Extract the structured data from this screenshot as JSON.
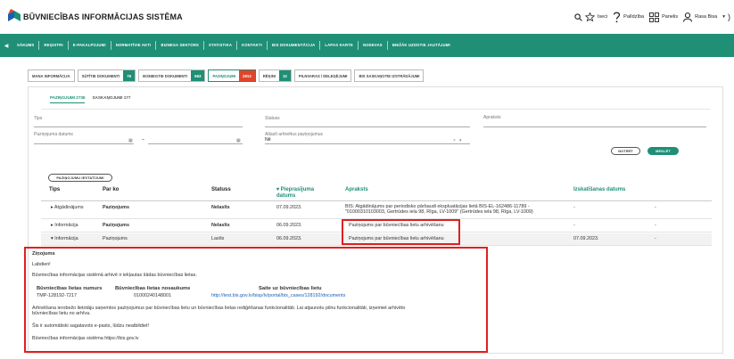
{
  "app": {
    "title": "BŪVNIECĪBAS INFORMĀCIJAS SISTĒMA"
  },
  "header": {
    "search_label": "Iseci",
    "help_label": "Palīdzība",
    "panel_label": "Panelis",
    "user_label": "Rasa Bisa"
  },
  "nav": {
    "items": [
      "SĀKUMS",
      "REĢISTRI",
      "E-PAKALPOJUMI",
      "NORMATĪVIE AKTI",
      "BIZNESA SEKTORS",
      "STATISTIKA",
      "KONTAKTI",
      "BIS DOKUMENTĀCIJA",
      "LAPAS KARTE",
      "NODEVAS",
      "BIEŽĀK UZDOTIE JAUTĀJUMI"
    ]
  },
  "doc_tabs": [
    {
      "label": "MANA INFORMĀCIJA",
      "count": ""
    },
    {
      "label": "SŪTĪTIE DOKUMENTI",
      "count": "76"
    },
    {
      "label": "IESNIEGTIE DOKUMENTI",
      "count": "663"
    },
    {
      "label": "PAZIŅOJUMI",
      "count": "2912"
    },
    {
      "label": "RĒĶINI",
      "count": "12"
    },
    {
      "label": "PILNVARAS / DELEĢĒJUMI",
      "count": ""
    },
    {
      "label": "BIS SASKAŅOTIE IZSTRĀDĀJUMI",
      "count": ""
    }
  ],
  "sub_tabs": [
    "PAZIŅOJUMI 2735",
    "SASKAŅOJUMI 177"
  ],
  "filters": {
    "tips_label": "Tips",
    "statuss_label": "Statuss",
    "apraksts_label": "Apraksts",
    "datums_label": "Paziņojuma datums",
    "dash": "–",
    "arhivetie_label": "Atlasīt arhivētus paziņojumus",
    "arhivetie_value": "Nē",
    "clear_button": "NOTĪRĪT",
    "search_button": "MEKLĒT",
    "columns_button": "PAZIŅOJUMU IESTATĪJUMI"
  },
  "table": {
    "headers": {
      "tips": "Tips",
      "par_ko": "Par ko",
      "statuss": "Statuss",
      "datums": "▾ Pieprasījuma datums",
      "apraksts": "Apraksts",
      "izsk_datums": "Izskatīšanas datums"
    },
    "rows": [
      {
        "tips": "▸ Atgādinājums",
        "par_ko": "Paziņojums",
        "statuss": "Nelasīts",
        "datums": "07.09.2023.",
        "apraksts_1": "BIS: Atgādinājums par periodisko pārbaudi ekspluatācijas lietā BIS-EL-162486-11789 -",
        "apraksts_2": "\"01000310103003, Gertrūdes iela 98, Rīga, LV-1009\" (Gertrūdes iela 98, Rīga, LV-1009)",
        "izsk": "-",
        "extra": "-"
      },
      {
        "tips": "▸ Informācija",
        "par_ko": "Paziņojums",
        "statuss": "Nelasīts",
        "datums": "06.09.2023.",
        "apraksts_1": "Paziņojums par būvniecības lietu arhivēšanu",
        "apraksts_2": "",
        "izsk": "-",
        "extra": "-"
      },
      {
        "tips": "▾ Informācija",
        "par_ko": "Paziņojums",
        "statuss": "Lasīts",
        "datums": "06.09.2023.",
        "apraksts_1": "Paziņojums par būvniecības lietu arhivēšanu",
        "apraksts_2": "",
        "izsk": "07.09.2023.",
        "extra": "-"
      }
    ]
  },
  "message": {
    "title": "Ziņojums",
    "greeting": "Labdien!",
    "intro": "Būvniecības informācijas sistēmā arhivē ir iekļautas šādas būvniecības lietas.",
    "col1": "Būvniecības lietas numurs",
    "col2": "Būvniecības lietas nosaukums",
    "col3": "Saite uz būvniecības lietu",
    "val1": "TMP-128192-7217",
    "val2": "01000240148001",
    "val3": "http://test.bis.gov.lv/bisp/lv/portal/bis_cases/128192/documents",
    "body_1": "Arhivēšana ierobežo lietotāju saņemtos paziņojumus par būvniecības lietu un būvniecības lietas rediģēšanas funkcionalitāti. Lai atjaunotu pilnu funkcionalitāti, izņemiet arhivēto",
    "body_2": "būvniecības lietu no arhīva.",
    "auto": "Šis ir automātiski sagatavots e-pasts, lūdzu neatbildiet!",
    "signature": "Būvniecības informācijas sistēma https://bis.gov.lv"
  },
  "colors": {
    "accent": "#1f8f76",
    "count_red": "#e0452c",
    "highlight": "#e02020"
  }
}
